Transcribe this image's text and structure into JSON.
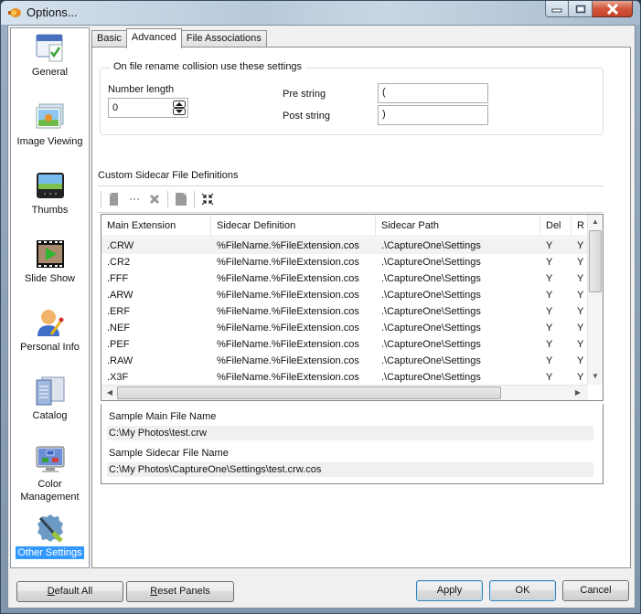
{
  "window": {
    "title": "Options...",
    "controls": {
      "minimize": "minimize",
      "maximize": "maximize",
      "close": "close"
    }
  },
  "sidebar": {
    "items": [
      {
        "label": "General",
        "icon": "general-settings-icon",
        "selected": false
      },
      {
        "label": "Image Viewing",
        "icon": "image-viewing-icon",
        "selected": false
      },
      {
        "label": "Thumbs",
        "icon": "thumbs-icon",
        "selected": false
      },
      {
        "label": "Slide Show",
        "icon": "slide-show-icon",
        "selected": false
      },
      {
        "label": "Personal Info",
        "icon": "personal-info-icon",
        "selected": false
      },
      {
        "label": "Catalog",
        "icon": "catalog-icon",
        "selected": false
      },
      {
        "label": "Color Management",
        "label_line1": "Color",
        "label_line2": "Management",
        "icon": "color-management-icon",
        "selected": false
      },
      {
        "label": "Other Settings",
        "icon": "other-settings-icon",
        "selected": true
      }
    ]
  },
  "tabs": [
    {
      "label": "Basic",
      "active": false
    },
    {
      "label": "Advanced",
      "active": true
    },
    {
      "label": "File Associations",
      "active": false
    }
  ],
  "collision": {
    "legend": "On file rename collision use these settings",
    "number_length_label": "Number length",
    "number_length_value": "0",
    "pre_string_label": "Pre string",
    "pre_string_value": "(",
    "post_string_label": "Post string",
    "post_string_value": ")"
  },
  "sidecar": {
    "section_title": "Custom Sidecar File Definitions",
    "toolbar": [
      {
        "name": "add-definition",
        "icon": "new-document-icon",
        "enabled": false
      },
      {
        "name": "edit-definition",
        "icon": "ellipsis-icon",
        "enabled": false
      },
      {
        "name": "delete-definition",
        "icon": "delete-x-icon",
        "enabled": false
      },
      {
        "name": "copy-definition",
        "icon": "page-icon",
        "enabled": false
      },
      {
        "name": "collapse",
        "icon": "collapse-arrows-icon",
        "enabled": true
      }
    ],
    "columns": [
      "Main Extension",
      "Sidecar Definition",
      "Sidecar Path",
      "Del",
      "R"
    ],
    "rows": [
      [
        ".CRW",
        "%FileName.%FileExtension.cos",
        ".\\CaptureOne\\Settings",
        "Y",
        "Y"
      ],
      [
        ".CR2",
        "%FileName.%FileExtension.cos",
        ".\\CaptureOne\\Settings",
        "Y",
        "Y"
      ],
      [
        ".FFF",
        "%FileName.%FileExtension.cos",
        ".\\CaptureOne\\Settings",
        "Y",
        "Y"
      ],
      [
        ".ARW",
        "%FileName.%FileExtension.cos",
        ".\\CaptureOne\\Settings",
        "Y",
        "Y"
      ],
      [
        ".ERF",
        "%FileName.%FileExtension.cos",
        ".\\CaptureOne\\Settings",
        "Y",
        "Y"
      ],
      [
        ".NEF",
        "%FileName.%FileExtension.cos",
        ".\\CaptureOne\\Settings",
        "Y",
        "Y"
      ],
      [
        ".PEF",
        "%FileName.%FileExtension.cos",
        ".\\CaptureOne\\Settings",
        "Y",
        "Y"
      ],
      [
        ".RAW",
        "%FileName.%FileExtension.cos",
        ".\\CaptureOne\\Settings",
        "Y",
        "Y"
      ],
      [
        ".X3F",
        "%FileName.%FileExtension.cos",
        ".\\CaptureOne\\Settings",
        "Y",
        "Y"
      ]
    ],
    "selected_row": 0,
    "samples": {
      "main_label": "Sample Main File Name",
      "main_value": "C:\\My Photos\\test.crw",
      "sidecar_label": "Sample Sidecar File Name",
      "sidecar_value": "C:\\My Photos\\CaptureOne\\Settings\\test.crw.cos"
    }
  },
  "buttons": {
    "default_all": {
      "mnemonic": "D",
      "rest": "efault All"
    },
    "reset_panels": {
      "mnemonic": "R",
      "rest": "eset Panels"
    },
    "apply": "Apply",
    "ok": "OK",
    "cancel": "Cancel"
  },
  "colors": {
    "selection": "#3399ff",
    "close_button": "#c4432a"
  }
}
